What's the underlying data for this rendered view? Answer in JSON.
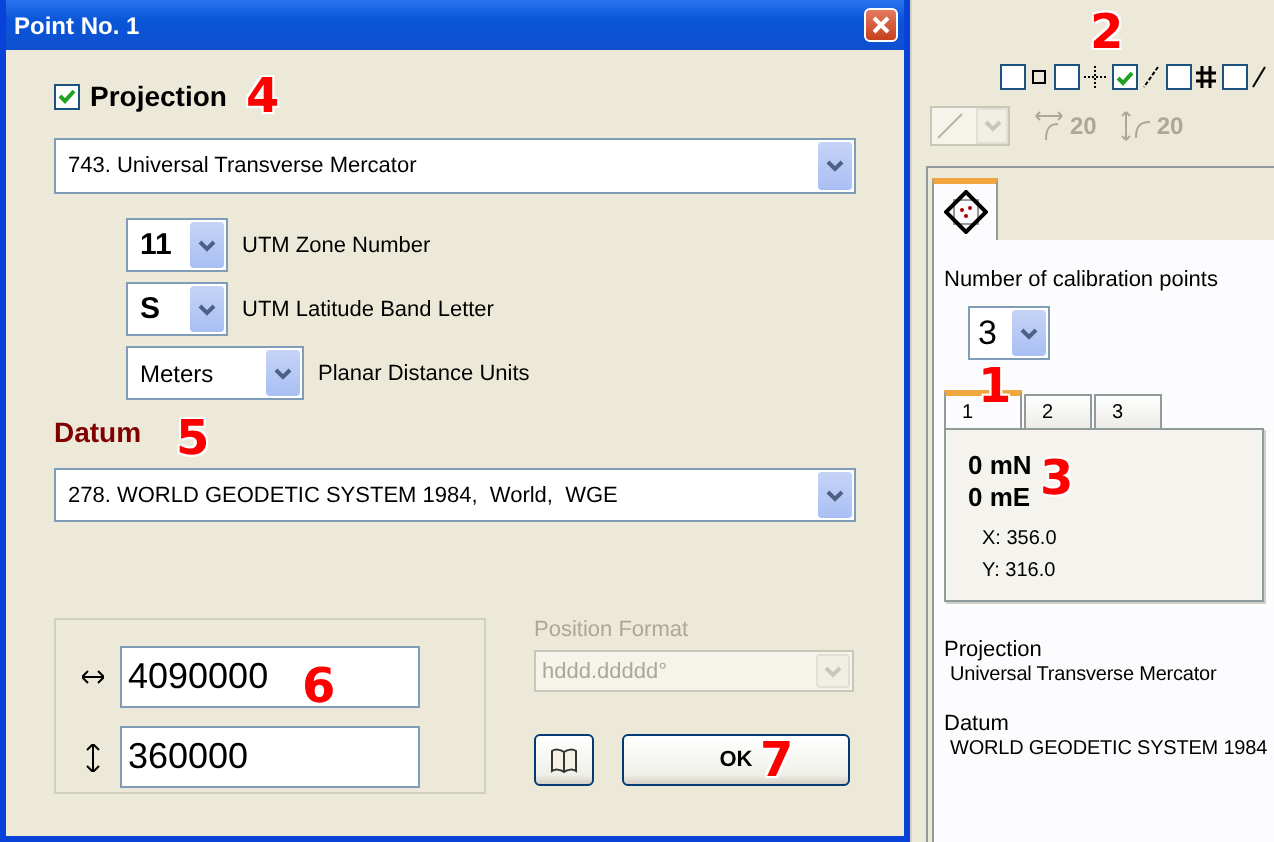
{
  "dialog": {
    "title": "Point No. 1",
    "projection": {
      "label": "Projection",
      "checked": true,
      "value": "743. Universal Transverse Mercator",
      "params": [
        {
          "value": "11",
          "label": "UTM Zone Number"
        },
        {
          "value": "S",
          "label": "UTM Latitude Band Letter"
        },
        {
          "value": "Meters",
          "label": "Planar Distance Units"
        }
      ]
    },
    "datum": {
      "label": "Datum",
      "value": "278. WORLD GEODETIC SYSTEM 1984,  World,  WGE"
    },
    "coordinates": [
      {
        "kind": "horizontal",
        "value": "4090000"
      },
      {
        "kind": "vertical",
        "value": "360000"
      }
    ],
    "position_format": {
      "label": "Position Format",
      "value": "hddd.ddddd°",
      "disabled": true
    },
    "ok_button": "OK"
  },
  "side_panel": {
    "toggles": [
      {
        "kind": "square",
        "checked": false
      },
      {
        "kind": "crosshair",
        "checked": false
      },
      {
        "kind": "slash",
        "checked": true
      },
      {
        "kind": "grid",
        "checked": false
      },
      {
        "kind": "line",
        "checked": false
      }
    ],
    "line_tools": {
      "disabled": true,
      "spacing": [
        {
          "kind": "horizontal",
          "value": "20"
        },
        {
          "kind": "vertical",
          "value": "20"
        }
      ]
    },
    "calibration": {
      "label": "Number of calibration points",
      "count": "3",
      "tabs": [
        {
          "label": "1",
          "selected": true
        },
        {
          "label": "2",
          "selected": false
        },
        {
          "label": "3",
          "selected": false
        }
      ],
      "northing": "0 mN",
      "easting": "0 mE",
      "x": "X: 356.0",
      "y": "Y: 316.0"
    },
    "info": [
      {
        "heading": "Projection",
        "value": "Universal Transverse Mercator"
      },
      {
        "heading": "Datum",
        "value": "WORLD GEODETIC SYSTEM 1984"
      }
    ]
  },
  "callouts": [
    "1",
    "2",
    "3",
    "4",
    "5",
    "6",
    "7"
  ]
}
